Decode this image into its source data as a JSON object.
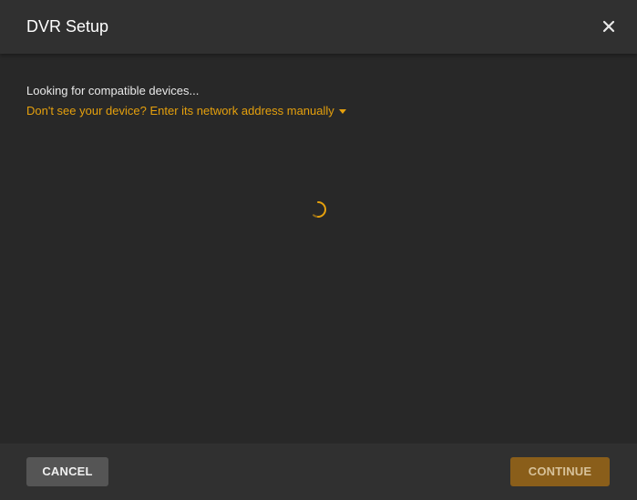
{
  "dialog": {
    "title": "DVR Setup",
    "close_icon": "close-icon"
  },
  "body": {
    "status_text": "Looking for compatible devices...",
    "manual_link_text": "Don't see your device? Enter its network address manually",
    "manual_link_icon": "caret-down-icon",
    "loading_icon": "spinner-icon"
  },
  "footer": {
    "cancel_label": "CANCEL",
    "continue_label": "CONTINUE",
    "continue_enabled": false
  },
  "colors": {
    "accent": "#e5a00d",
    "background": "#282828",
    "header_footer": "#303030",
    "continue_disabled_bg": "#8a5e1a",
    "cancel_bg": "#555555"
  }
}
